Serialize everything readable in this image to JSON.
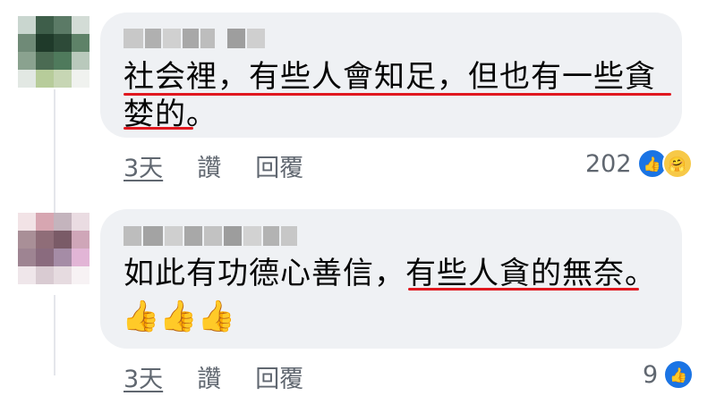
{
  "comments": [
    {
      "text_line1": "社会裡，有些人會知足，但也有一些貪",
      "text_line2": "婪的。",
      "time": "3天",
      "like_label": "讚",
      "reply_label": "回覆",
      "reaction_count": "202",
      "reactions": [
        "like-icon",
        "care-icon"
      ]
    },
    {
      "text_part1": "如此有功德心善信，",
      "text_part2": "有些人貪的無奈",
      "text_part3": "。",
      "emoji": "👍👍👍",
      "time": "3天",
      "like_label": "讚",
      "reply_label": "回覆",
      "reaction_count": "9",
      "reactions": [
        "like-icon"
      ]
    }
  ],
  "colors": {
    "bubble": "#eff1f4",
    "underline": "#e0181f",
    "meta_text": "#606770",
    "like_blue": "#1b74e4"
  }
}
